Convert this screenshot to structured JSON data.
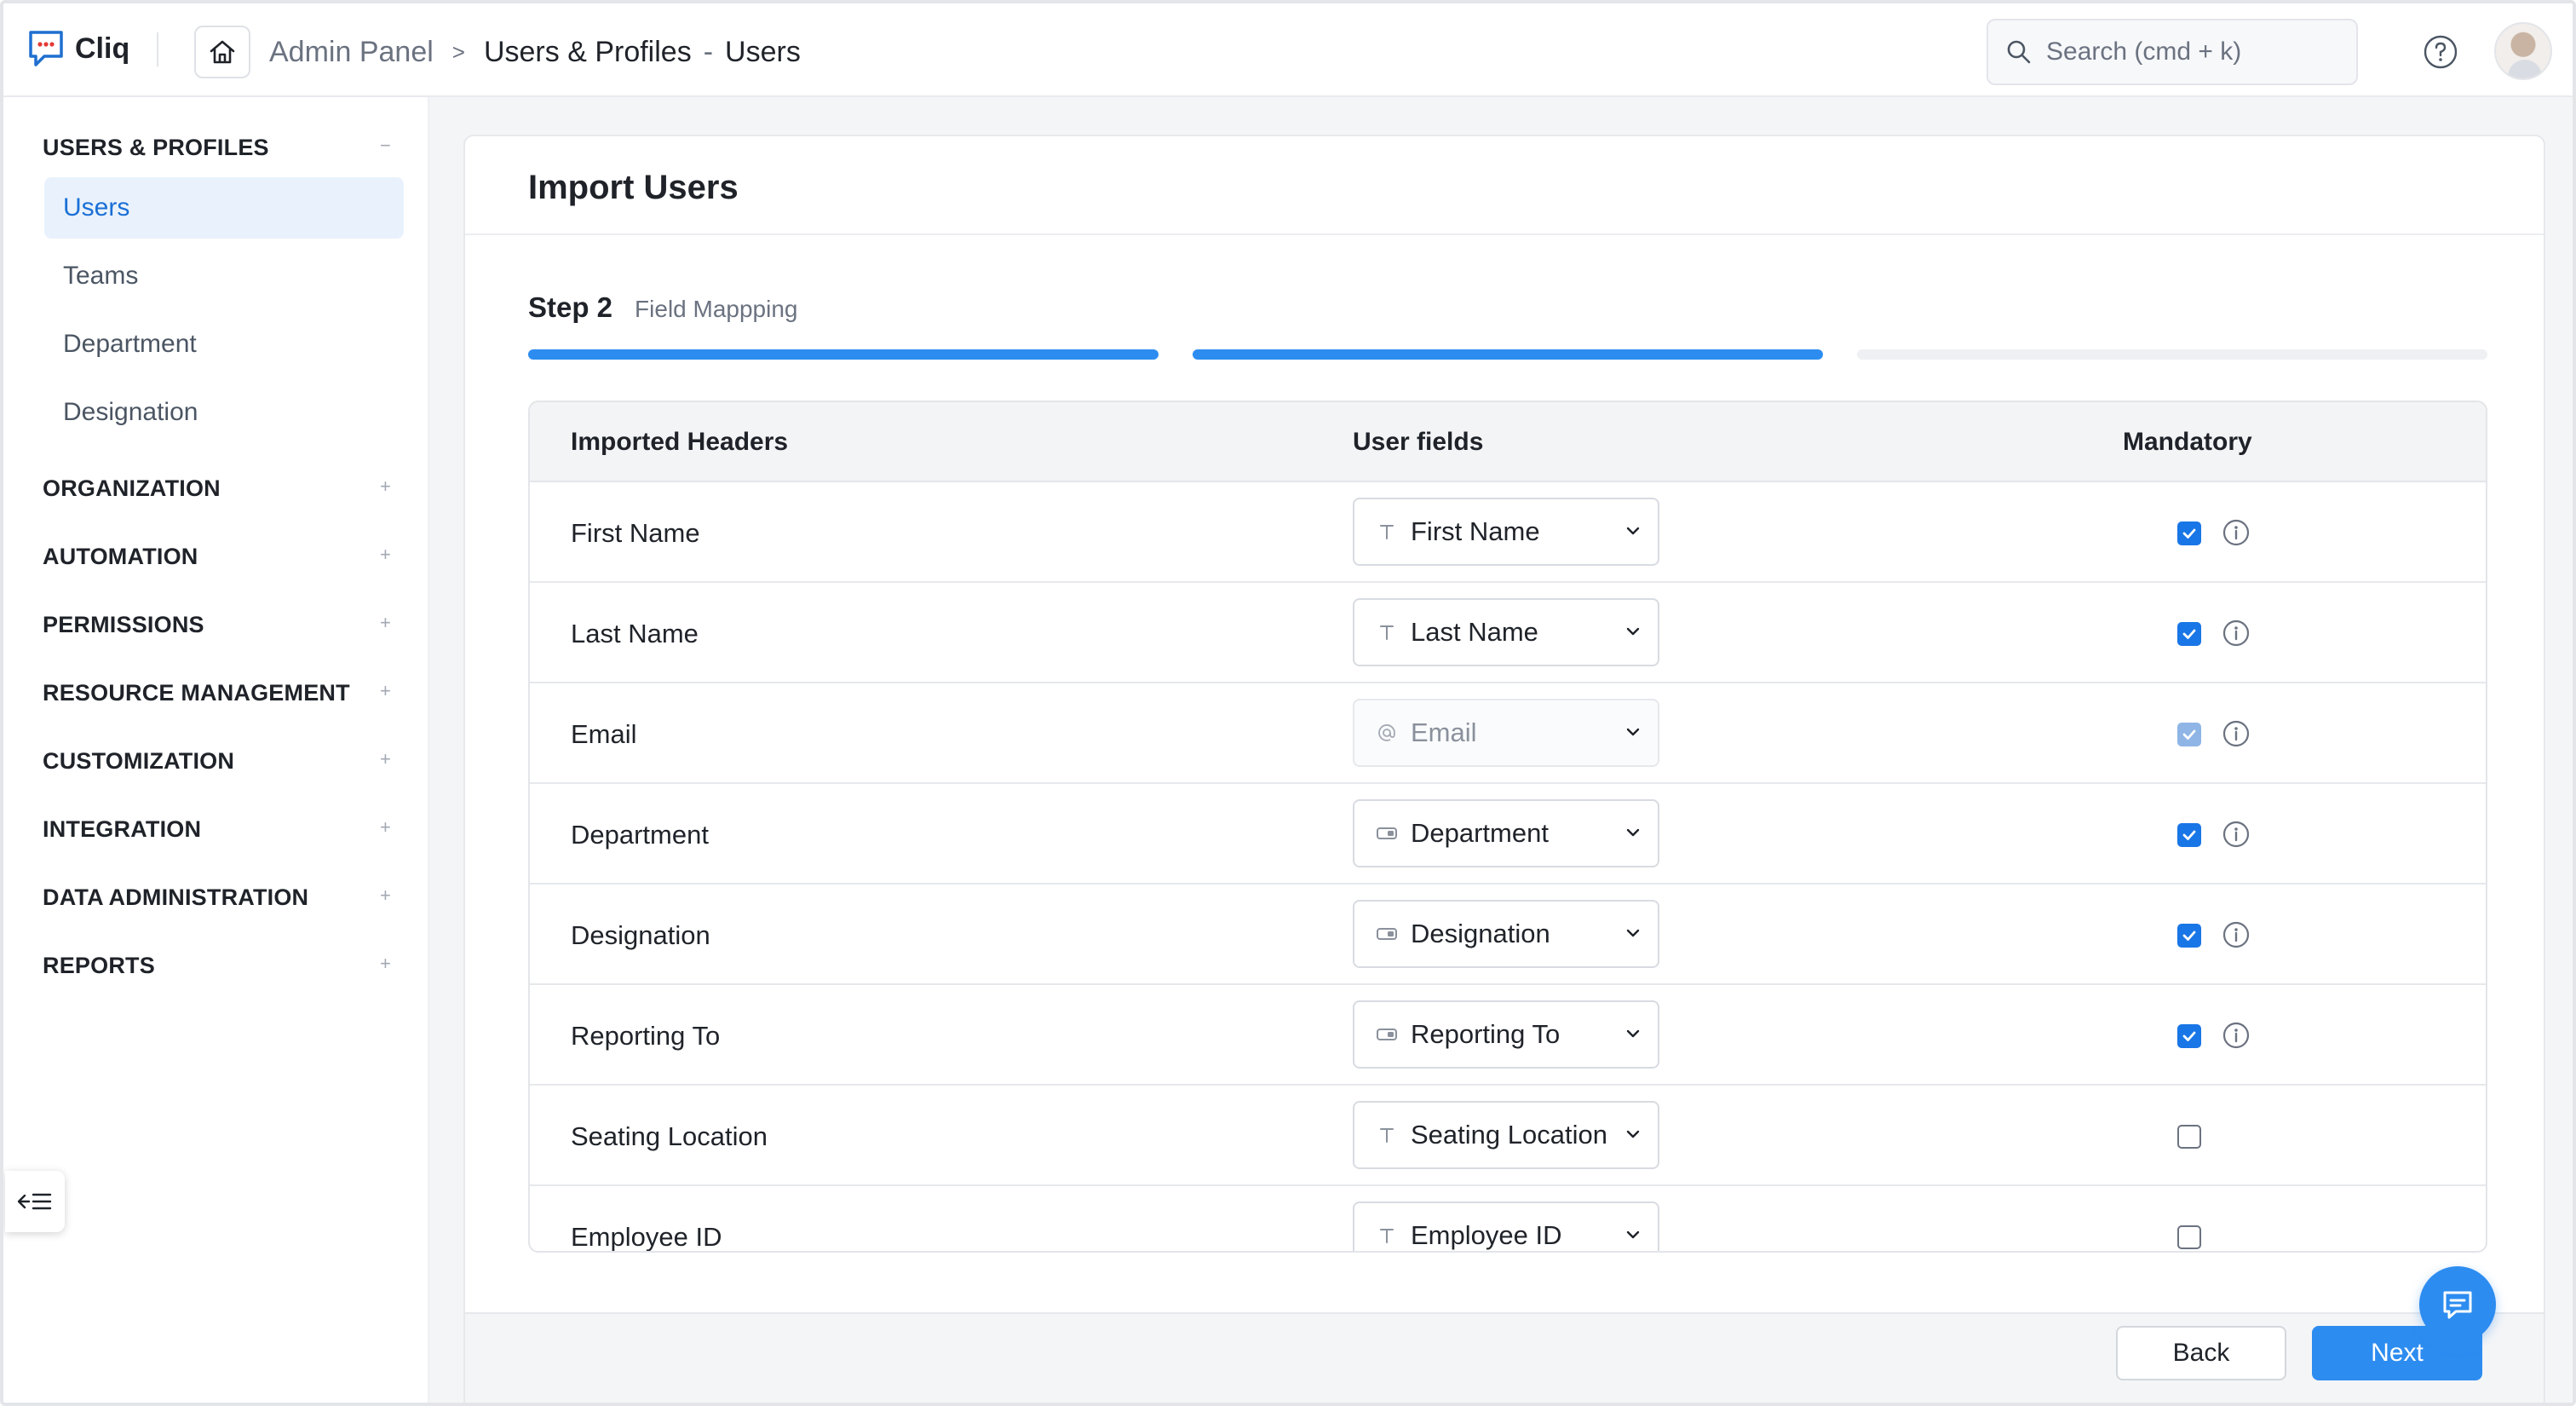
{
  "app": {
    "name": "Cliq"
  },
  "breadcrumb": {
    "root": "Admin Panel",
    "separator": ">",
    "section": "Users & Profiles",
    "dash": "-",
    "page": "Users"
  },
  "search": {
    "placeholder": "Search (cmd + k)"
  },
  "sidebar": {
    "sections": [
      {
        "label": "USERS & PROFILES",
        "toggle": "−",
        "items": [
          {
            "label": "Users",
            "active": true
          },
          {
            "label": "Teams"
          },
          {
            "label": "Department"
          },
          {
            "label": "Designation"
          }
        ]
      },
      {
        "label": "ORGANIZATION",
        "toggle": "+"
      },
      {
        "label": "AUTOMATION",
        "toggle": "+"
      },
      {
        "label": "PERMISSIONS",
        "toggle": "+"
      },
      {
        "label": "RESOURCE MANAGEMENT",
        "toggle": "+"
      },
      {
        "label": "CUSTOMIZATION",
        "toggle": "+"
      },
      {
        "label": "INTEGRATION",
        "toggle": "+"
      },
      {
        "label": "DATA ADMINISTRATION",
        "toggle": "+"
      },
      {
        "label": "REPORTS",
        "toggle": "+"
      }
    ]
  },
  "main": {
    "title": "Import Users",
    "step": {
      "number": "Step 2",
      "name": "Field Mappping",
      "completed": 2,
      "total": 3
    },
    "table": {
      "headers": [
        "Imported Headers",
        "User fields",
        "Mandatory"
      ],
      "rows": [
        {
          "header": "First Name",
          "field": "First Name",
          "icon": "text-icon",
          "mandatory": true,
          "disabled": false,
          "info": true
        },
        {
          "header": "Last Name",
          "field": "Last Name",
          "icon": "text-icon",
          "mandatory": true,
          "disabled": false,
          "info": true
        },
        {
          "header": "Email",
          "field": "Email",
          "icon": "at-icon",
          "mandatory": true,
          "disabled": true,
          "info": true
        },
        {
          "header": "Department",
          "field": "Department",
          "icon": "lookup-icon",
          "mandatory": true,
          "disabled": false,
          "info": true
        },
        {
          "header": "Designation",
          "field": "Designation",
          "icon": "lookup-icon",
          "mandatory": true,
          "disabled": false,
          "info": true
        },
        {
          "header": "Reporting To",
          "field": "Reporting To",
          "icon": "lookup-icon",
          "mandatory": true,
          "disabled": false,
          "info": true
        },
        {
          "header": "Seating Location",
          "field": "Seating Location",
          "icon": "text-icon",
          "mandatory": false,
          "disabled": false,
          "info": false
        },
        {
          "header": "Employee ID",
          "field": "Employee ID",
          "icon": "text-icon",
          "mandatory": false,
          "disabled": false,
          "info": false
        }
      ]
    },
    "buttons": {
      "back": "Back",
      "next": "Next"
    }
  },
  "colors": {
    "accent": "#2d8cf0",
    "active_bg": "#e9f2fc",
    "checkbox": "#1976e6",
    "progress_empty": "#eef0f3"
  }
}
